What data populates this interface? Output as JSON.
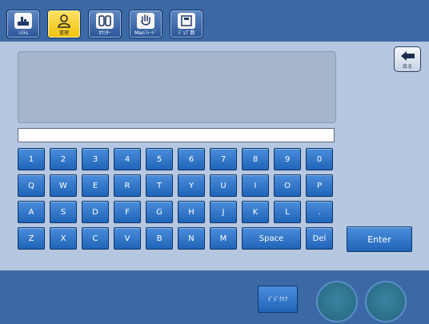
{
  "tabs": [
    {
      "label": "ｼｽﾃﾑ",
      "icon": "tools-icon",
      "active": false
    },
    {
      "label": "管理",
      "icon": "user-icon",
      "active": true
    },
    {
      "label": "ｶｳﾝﾀｰ",
      "icon": "counter-icon",
      "active": false
    },
    {
      "label": "Manﾌｨｰﾄﾞ",
      "icon": "hand-icon",
      "active": false
    },
    {
      "label": "ｼﾞｮﾌﾞ数",
      "icon": "job-icon",
      "active": false
    }
  ],
  "back_button": {
    "label": "戻る",
    "icon": "back-arrow-icon"
  },
  "entry": {
    "value": ""
  },
  "keyboard": {
    "row1": [
      "1",
      "2",
      "3",
      "4",
      "5",
      "6",
      "7",
      "8",
      "9",
      "0"
    ],
    "row2": [
      "Q",
      "W",
      "E",
      "R",
      "T",
      "Y",
      "U",
      "I",
      "O",
      "P"
    ],
    "row3": [
      "A",
      "S",
      "D",
      "F",
      "G",
      "H",
      "J",
      "K",
      "L",
      "."
    ],
    "row4": [
      "Z",
      "X",
      "C",
      "V",
      "B",
      "N",
      "M"
    ],
    "space": "Space",
    "del": "Del",
    "enter": "Enter"
  },
  "bottom": {
    "clear_label": "ﾃﾞｼﾞｸﾘｱ"
  },
  "colors": {
    "bar": "#3c69a5",
    "panel": "#b6c7e1",
    "key": "#2f79cf",
    "active_tab": "#f7d22a"
  }
}
